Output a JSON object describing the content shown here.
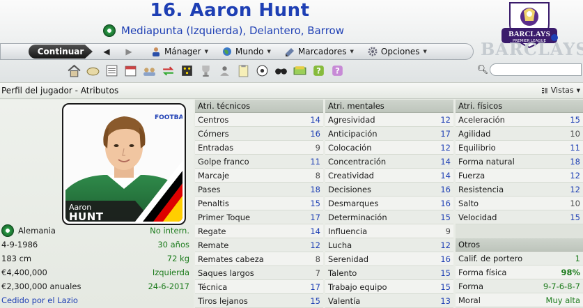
{
  "header": {
    "player_title": "16. Aaron Hunt",
    "position_line": "Mediapunta (Izquierda), Delantero, Barrow",
    "league_badge_text": "BARCLAYS",
    "league_badge_sub": "PREMIER LEAGUE",
    "watermark": "BARCLAYS"
  },
  "nav": {
    "continue_label": "Continuar",
    "back_arrow": "◀",
    "forward_arrow": "▶",
    "menus": [
      {
        "label": "Mánager",
        "icon": "manager-icon"
      },
      {
        "label": "Mundo",
        "icon": "globe-icon"
      },
      {
        "label": "Marcadores",
        "icon": "bookmarks-icon"
      },
      {
        "label": "Opciones",
        "icon": "options-gear-icon"
      }
    ]
  },
  "toolbar": {
    "icons": [
      "home-icon",
      "inbox-icon",
      "news-icon",
      "calendar-icon",
      "squad-icon",
      "transfers-icon",
      "tactics-icon",
      "trophy-icon",
      "staff-icon",
      "notes-icon",
      "match-icon",
      "scout-binoculars-icon",
      "finance-icon",
      "help-icon",
      "wiki-icon"
    ]
  },
  "search": {
    "placeholder": ""
  },
  "subheader": {
    "title": "Perfil del jugador - Atributos",
    "views_label": "Vistas"
  },
  "card": {
    "first_name": "Aaron",
    "last_name": "HUNT",
    "watermark": "FOOTBALL"
  },
  "info": [
    {
      "label": "Alemania",
      "value": "No intern."
    },
    {
      "label": "4-9-1986",
      "value": "30 años"
    },
    {
      "label": "183 cm",
      "value": "72 kg"
    },
    {
      "label": "€4,400,000",
      "value": "Izquierda"
    },
    {
      "label": "€2,300,000 anuales",
      "value": "24-6-2017"
    },
    {
      "label": "Cedido por el Lazio",
      "value": ""
    }
  ],
  "technical": {
    "heading": "Atri. técnicos",
    "rows": [
      {
        "name": "Centros",
        "value": "14"
      },
      {
        "name": "Córners",
        "value": "16"
      },
      {
        "name": "Entradas",
        "value": "9"
      },
      {
        "name": "Golpe franco",
        "value": "11"
      },
      {
        "name": "Marcaje",
        "value": "8"
      },
      {
        "name": "Pases",
        "value": "18"
      },
      {
        "name": "Penaltis",
        "value": "15"
      },
      {
        "name": "Primer Toque",
        "value": "17"
      },
      {
        "name": "Regate",
        "value": "14"
      },
      {
        "name": "Remate",
        "value": "12"
      },
      {
        "name": "Remates cabeza",
        "value": "8"
      },
      {
        "name": "Saques largos",
        "value": "7"
      },
      {
        "name": "Técnica",
        "value": "17"
      },
      {
        "name": "Tiros lejanos",
        "value": "15"
      }
    ]
  },
  "mental": {
    "heading": "Atri. mentales",
    "rows": [
      {
        "name": "Agresividad",
        "value": "12"
      },
      {
        "name": "Anticipación",
        "value": "17"
      },
      {
        "name": "Colocación",
        "value": "12"
      },
      {
        "name": "Concentración",
        "value": "14"
      },
      {
        "name": "Creatividad",
        "value": "14"
      },
      {
        "name": "Decisiones",
        "value": "16"
      },
      {
        "name": "Desmarques",
        "value": "16"
      },
      {
        "name": "Determinación",
        "value": "15"
      },
      {
        "name": "Influencia",
        "value": "9"
      },
      {
        "name": "Lucha",
        "value": "12"
      },
      {
        "name": "Serenidad",
        "value": "16"
      },
      {
        "name": "Talento",
        "value": "15"
      },
      {
        "name": "Trabajo equipo",
        "value": "15"
      },
      {
        "name": "Valentía",
        "value": "13"
      }
    ]
  },
  "physical": {
    "heading": "Atri. físicos",
    "rows": [
      {
        "name": "Aceleración",
        "value": "15"
      },
      {
        "name": "Agilidad",
        "value": "10"
      },
      {
        "name": "Equilibrio",
        "value": "11"
      },
      {
        "name": "Forma natural",
        "value": "18"
      },
      {
        "name": "Fuerza",
        "value": "12"
      },
      {
        "name": "Resistencia",
        "value": "12"
      },
      {
        "name": "Salto",
        "value": "10"
      },
      {
        "name": "Velocidad",
        "value": "15"
      }
    ]
  },
  "others": {
    "heading": "Otros",
    "rows": [
      {
        "name": "Calif. de portero",
        "value": "1"
      },
      {
        "name": "Forma física",
        "value": "98%"
      },
      {
        "name": "Forma",
        "value": "9-7-6-8-7"
      },
      {
        "name": "Moral",
        "value": "Muy alta"
      }
    ]
  },
  "colors": {
    "title_blue": "#1e3fb4",
    "value_green": "#1a7a1a",
    "nav_dark": "#151515"
  }
}
